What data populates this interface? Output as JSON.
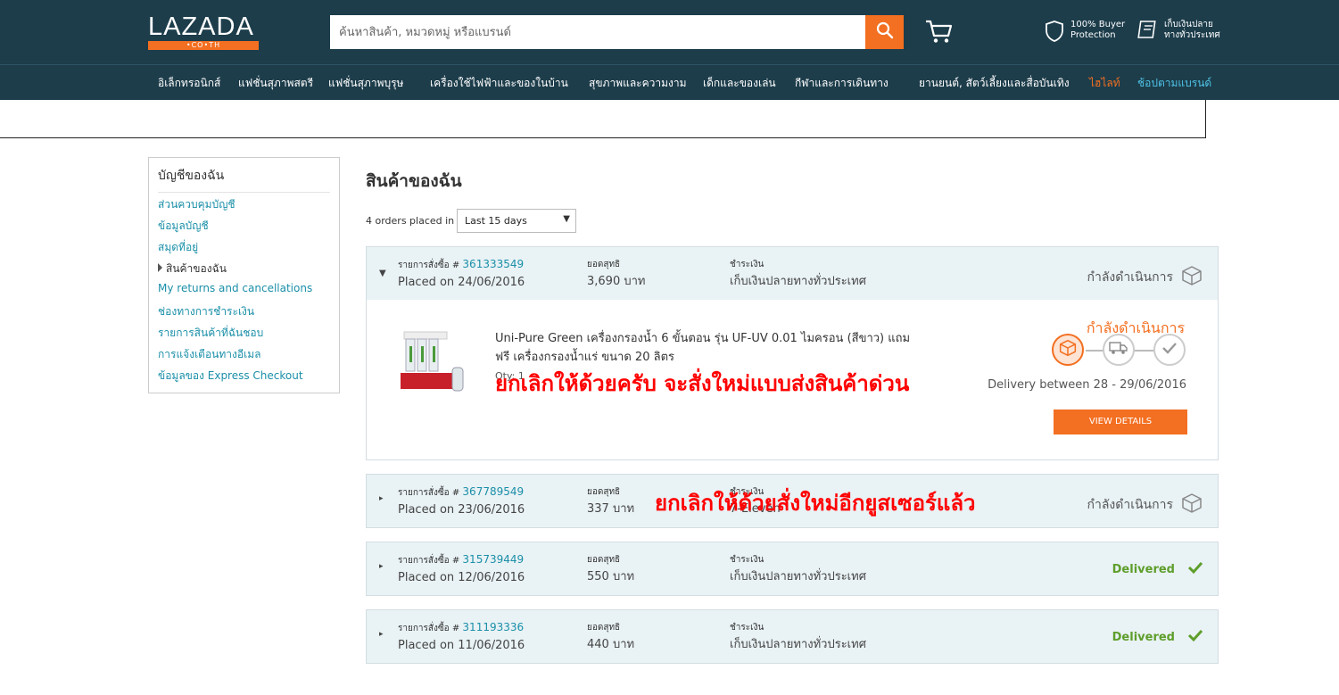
{
  "header": {
    "logo_text": "LAZADA",
    "logo_sub": "•CO•TH",
    "search_placeholder": "ค้นหาสินค้า, หมวดหมู่ หรือแบรนด์",
    "promo_protection": "100% Buyer Protection",
    "promo_cod": "เก็บเงินปลายทางทั่วประเทศ",
    "icons": [
      "search-icon",
      "cart-icon",
      "shield-icon",
      "cod-icon"
    ]
  },
  "categories": [
    "อิเล็กทรอนิกส์",
    "แฟชั่นสุภาพสตรี",
    "แฟชั่นสุภาพบุรุษ",
    "เครื่องใช้ไฟฟ้าและของในบ้าน",
    "สุขภาพและความงาม",
    "เด็กและของเล่น",
    "กีฬาและการเดินทาง",
    "ยานยนต์, สัตว์เลี้ยงและสื่อบันเทิง",
    "ไฮไลท์",
    "ช้อปตามแบรนด์"
  ],
  "sidebar": {
    "title": "บัญชีของฉัน",
    "items": [
      "ส่วนควบคุมบัญชี",
      "ข้อมูลบัญชี",
      "สมุดที่อยู่",
      "สินค้าของฉัน",
      "My returns and cancellations",
      "ช่องทางการชำระเงิน",
      "รายการสินค้าที่ฉันชอบ",
      "การแจ้งเตือนทางอีเมล",
      "ข้อมูลของ Express Checkout"
    ],
    "active_index": 3
  },
  "main": {
    "title": "สินค้าของฉัน",
    "orders_placed": "4 orders placed in",
    "period": "Last 15 days"
  },
  "order_labels": {
    "order_no": "รายการสั่งซื้อ #",
    "total": "ยอดสุทธิ",
    "payment": "ชำระเงิน"
  },
  "orders": [
    {
      "number": "361333549",
      "placed": "Placed on 24/06/2016",
      "total": "3,690 บาท",
      "payment": "เก็บเงินปลายทางทั่วประเทศ",
      "status": "กำลังดำเนินการ"
    },
    {
      "number": "367789549",
      "placed": "Placed on 23/06/2016",
      "total": "337 บาท",
      "payment": "7-Eleven",
      "status": "กำลังดำเนินการ"
    },
    {
      "number": "315739449",
      "placed": "Placed on 12/06/2016",
      "total": "550 บาท",
      "payment": "เก็บเงินปลายทางทั่วประเทศ",
      "status": "Delivered"
    },
    {
      "number": "311193336",
      "placed": "Placed on 11/06/2016",
      "total": "440 บาท",
      "payment": "เก็บเงินปลายทางทั่วประเทศ",
      "status": "Delivered"
    }
  ],
  "detail": {
    "product_name": "Uni-Pure Green เครื่องกรองน้ำ 6 ขั้นตอน รุ่น UF-UV 0.01 ไมครอน (สีขาว) แถม ฟรี เครื่องกรองน้ำแร่ ขนาด 20 ลิตร",
    "qty": "Qty: 1",
    "step_title": "กำลังดำเนินการ",
    "delivery": "Delivery between 28 - 29/06/2016",
    "button": "VIEW DETAILS"
  },
  "annotations": {
    "first": "ยกเลิกให้ด้วยครับ จะสั่งใหม่แบบส่งสินค้าด่วน",
    "second": "ยกเลิกให้ด้วยสั่งใหม่อีกยูสเซอร์แล้ว"
  },
  "colors": {
    "header_bg": "#1d3d4b",
    "accent": "#f36f21",
    "link": "#1a8fa8",
    "delivered": "#5e9e2b",
    "order_bg": "#e9f2f5",
    "annotation": "#ff0000"
  }
}
